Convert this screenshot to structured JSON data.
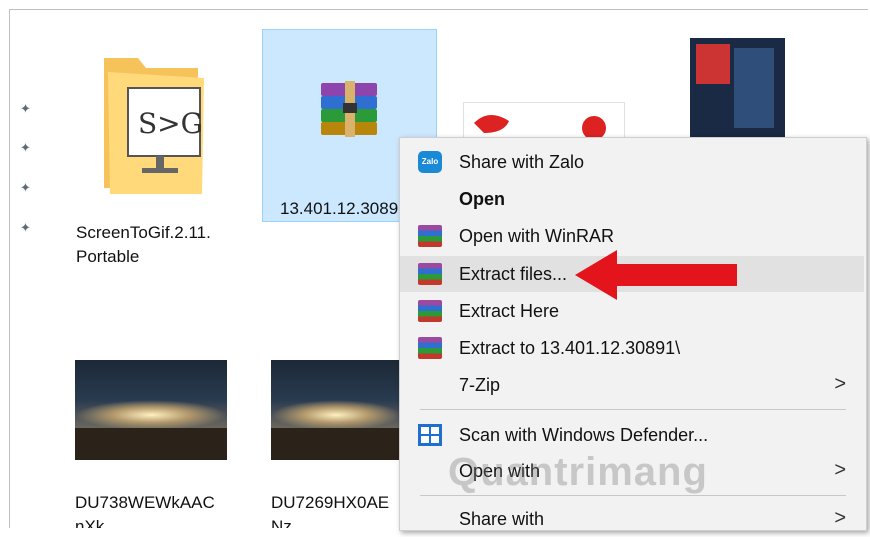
{
  "files": [
    {
      "name_line1": "ScreenToGif.2.11.",
      "name_line2": "Portable",
      "icon": "folder-screentogif-icon"
    },
    {
      "name_line1": "13.401.12.3089",
      "name_line2": "",
      "icon": "winrar-archive-icon"
    },
    {
      "name_line1": "DU738WEWkAAC",
      "name_line2": "nXk",
      "icon": "concert-thumbnail"
    },
    {
      "name_line1": "DU7269HX0AE",
      "name_line2": "Nz",
      "icon": "concert-thumbnail"
    }
  ],
  "context_menu": {
    "items": [
      {
        "label": "Share with Zalo",
        "icon": "zalo-icon"
      },
      {
        "label": "Open",
        "icon": ""
      },
      {
        "label": "Open with WinRAR",
        "icon": "winrar-icon"
      },
      {
        "label": "Extract files...",
        "icon": "winrar-icon"
      },
      {
        "label": "Extract Here",
        "icon": "winrar-icon"
      },
      {
        "label": "Extract to 13.401.12.30891\\",
        "icon": "winrar-icon"
      },
      {
        "label": "7-Zip",
        "icon": "",
        "has_submenu": true
      },
      {
        "label": "Scan with Windows Defender...",
        "icon": "windows-defender-icon"
      },
      {
        "label": "Open with",
        "icon": "",
        "has_submenu": true
      },
      {
        "label": "Share with",
        "icon": "",
        "has_submenu": true
      }
    ]
  },
  "watermark": "Quantrimang",
  "colors": {
    "selection": "#cce8ff",
    "menu_bg": "#f2f2f2",
    "arrow": "#e3141b",
    "highlight": "#e1e1e1"
  }
}
